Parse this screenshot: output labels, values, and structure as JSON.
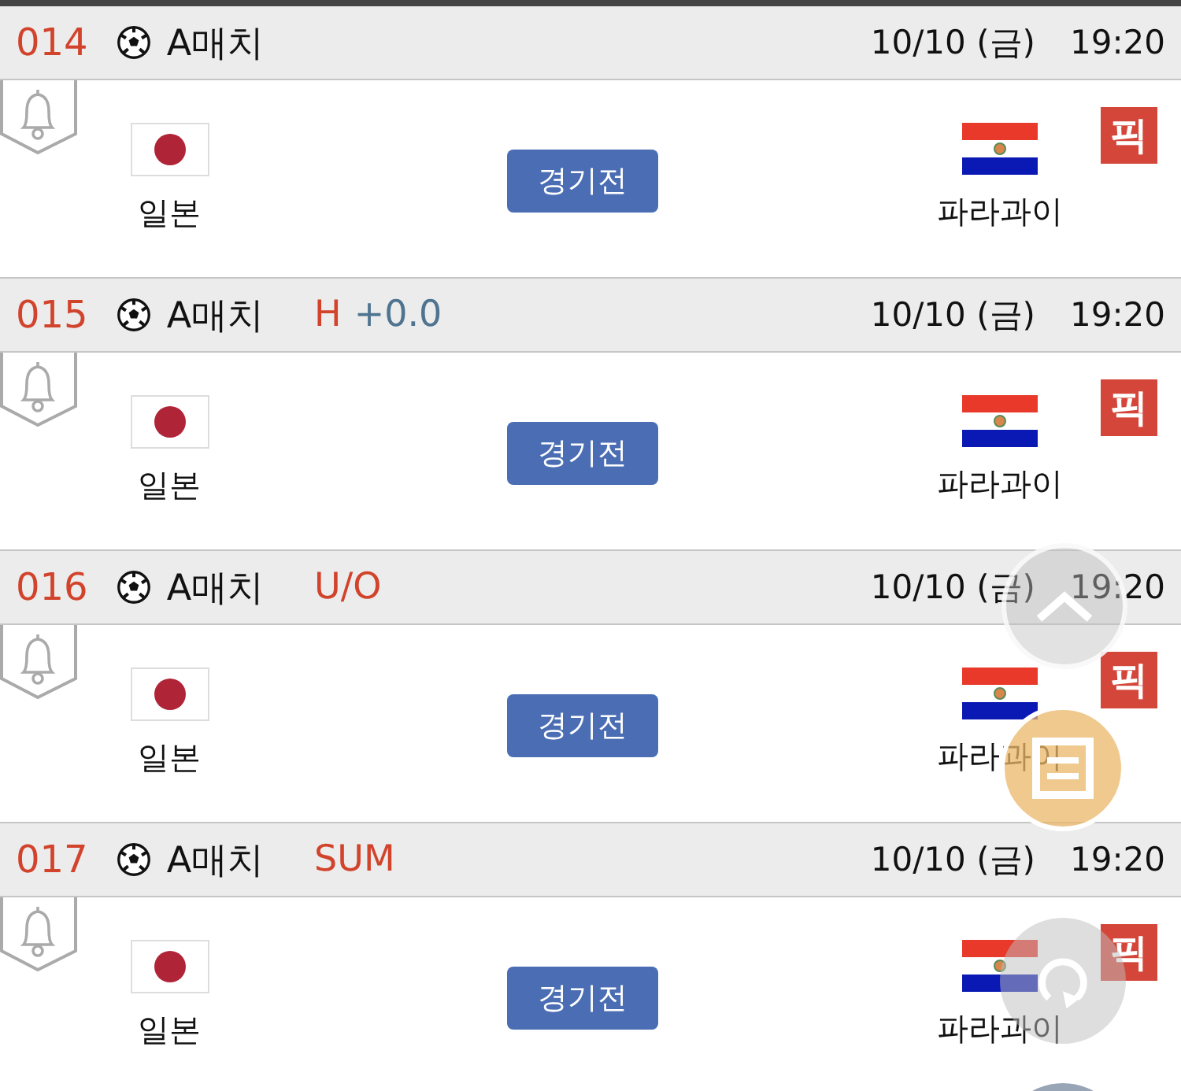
{
  "matches": [
    {
      "number": "014",
      "league": "A매치",
      "date": "10/10 (금)",
      "time": "19:20",
      "home": "일본",
      "away": "파라과이",
      "status": "경기전",
      "pick": "픽"
    },
    {
      "number": "015",
      "league": "A매치",
      "market": "H",
      "handicap": "+0.0",
      "date": "10/10 (금)",
      "time": "19:20",
      "home": "일본",
      "away": "파라과이",
      "status": "경기전",
      "pick": "픽"
    },
    {
      "number": "016",
      "league": "A매치",
      "market": "U/O",
      "date": "10/10 (금)",
      "time": "19:20",
      "home": "일본",
      "away": "파라과이",
      "status": "경기전",
      "pick": "픽"
    },
    {
      "number": "017",
      "league": "A매치",
      "market": "SUM",
      "date": "10/10 (금)",
      "time": "19:20",
      "home": "일본",
      "away": "파라과이",
      "status": "경기전",
      "pick": "픽"
    }
  ]
}
